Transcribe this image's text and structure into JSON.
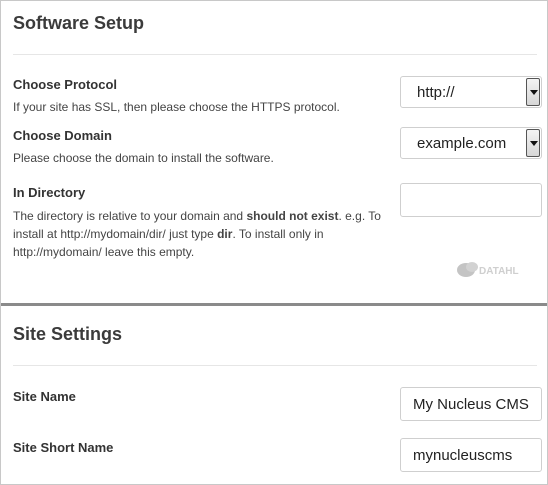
{
  "software_setup": {
    "title": "Software Setup",
    "protocol": {
      "label": "Choose Protocol",
      "description": "If your site has SSL, then please choose the HTTPS protocol.",
      "selected": "http://"
    },
    "domain": {
      "label": "Choose Domain",
      "description": "Please choose the domain to install the software.",
      "selected": "example.com"
    },
    "directory": {
      "label": "In Directory",
      "desc_part1": "The directory is relative to your domain and ",
      "desc_bold1": "should not exist",
      "desc_part2": ". e.g. To install at http://mydomain/dir/ just type ",
      "desc_bold2": "dir",
      "desc_part3": ". To install only in http://mydomain/ leave this empty.",
      "value": ""
    },
    "watermark": {
      "text": "DATAHL",
      "icon": "datahl-logo-icon"
    }
  },
  "site_settings": {
    "title": "Site Settings",
    "site_name": {
      "label": "Site Name",
      "value": "My Nucleus CMS"
    },
    "site_short_name": {
      "label": "Site Short Name",
      "value": "mynucleuscms"
    }
  }
}
